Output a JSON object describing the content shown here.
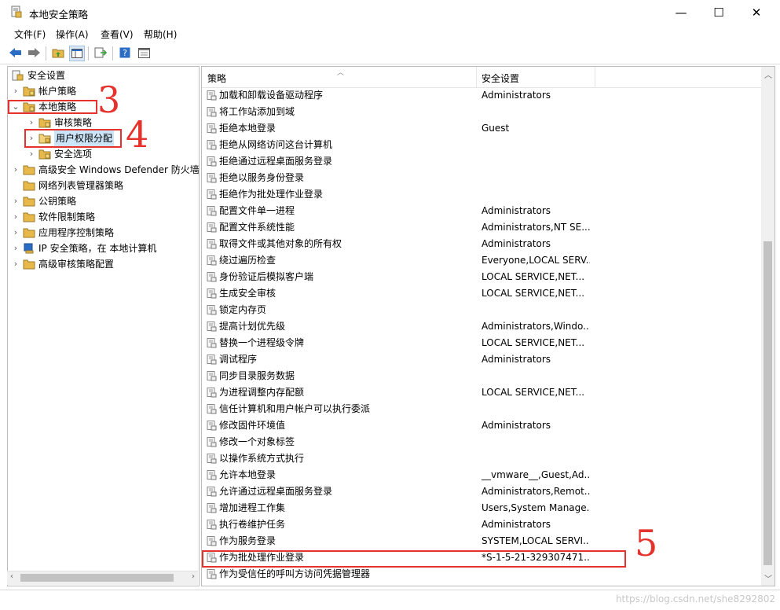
{
  "window": {
    "title": "本地安全策略",
    "minimize": "—",
    "maximize": "☐",
    "close": "✕"
  },
  "menu": [
    "文件(F)",
    "操作(A)",
    "查看(V)",
    "帮助(H)"
  ],
  "tree": [
    {
      "label": "安全设置",
      "expander": ""
    },
    {
      "label": "帐户策略",
      "expander": "›"
    },
    {
      "label": "本地策略",
      "expander": "⌄"
    },
    {
      "label": "审核策略",
      "expander": "›"
    },
    {
      "label": "用户权限分配",
      "expander": "›"
    },
    {
      "label": "安全选项",
      "expander": "›"
    },
    {
      "label": "高级安全 Windows Defender 防火墙",
      "expander": "›"
    },
    {
      "label": "网络列表管理器策略",
      "expander": ""
    },
    {
      "label": "公钥策略",
      "expander": "›"
    },
    {
      "label": "软件限制策略",
      "expander": "›"
    },
    {
      "label": "应用程序控制策略",
      "expander": "›"
    },
    {
      "label": "IP 安全策略，在 本地计算机",
      "expander": "›"
    },
    {
      "label": "高级审核策略配置",
      "expander": "›"
    }
  ],
  "table": {
    "columns": [
      "策略",
      "安全设置"
    ],
    "rows": [
      [
        "加载和卸载设备驱动程序",
        "Administrators"
      ],
      [
        "将工作站添加到域",
        ""
      ],
      [
        "拒绝本地登录",
        "Guest"
      ],
      [
        "拒绝从网络访问这台计算机",
        ""
      ],
      [
        "拒绝通过远程桌面服务登录",
        ""
      ],
      [
        "拒绝以服务身份登录",
        ""
      ],
      [
        "拒绝作为批处理作业登录",
        ""
      ],
      [
        "配置文件单一进程",
        "Administrators"
      ],
      [
        "配置文件系统性能",
        "Administrators,NT SE..."
      ],
      [
        "取得文件或其他对象的所有权",
        "Administrators"
      ],
      [
        "绕过遍历检查",
        "Everyone,LOCAL SERV..."
      ],
      [
        "身份验证后模拟客户端",
        "LOCAL SERVICE,NET..."
      ],
      [
        "生成安全审核",
        "LOCAL SERVICE,NET..."
      ],
      [
        "锁定内存页",
        ""
      ],
      [
        "提高计划优先级",
        "Administrators,Windo..."
      ],
      [
        "替换一个进程级令牌",
        "LOCAL SERVICE,NET..."
      ],
      [
        "调试程序",
        "Administrators"
      ],
      [
        "同步目录服务数据",
        ""
      ],
      [
        "为进程调整内存配额",
        "LOCAL SERVICE,NET..."
      ],
      [
        "信任计算机和用户帐户可以执行委派",
        ""
      ],
      [
        "修改固件环境值",
        "Administrators"
      ],
      [
        "修改一个对象标签",
        ""
      ],
      [
        "以操作系统方式执行",
        ""
      ],
      [
        "允许本地登录",
        "__vmware__,Guest,Ad..."
      ],
      [
        "允许通过远程桌面服务登录",
        "Administrators,Remot..."
      ],
      [
        "增加进程工作集",
        "Users,System Manage..."
      ],
      [
        "执行卷维护任务",
        "Administrators"
      ],
      [
        "作为服务登录",
        "SYSTEM,LOCAL SERVI..."
      ],
      [
        "作为批处理作业登录",
        "*S-1-5-21-329307471..."
      ],
      [
        "作为受信任的呼叫方访问凭据管理器",
        ""
      ]
    ]
  },
  "annotations": {
    "n3": "3",
    "n4": "4",
    "n5": "5"
  },
  "watermark": "https://blog.csdn.net/she8292802",
  "colors": {
    "annotation": "#e5322d",
    "folder": "#e8b94a",
    "accent": "#2b6cc4"
  }
}
